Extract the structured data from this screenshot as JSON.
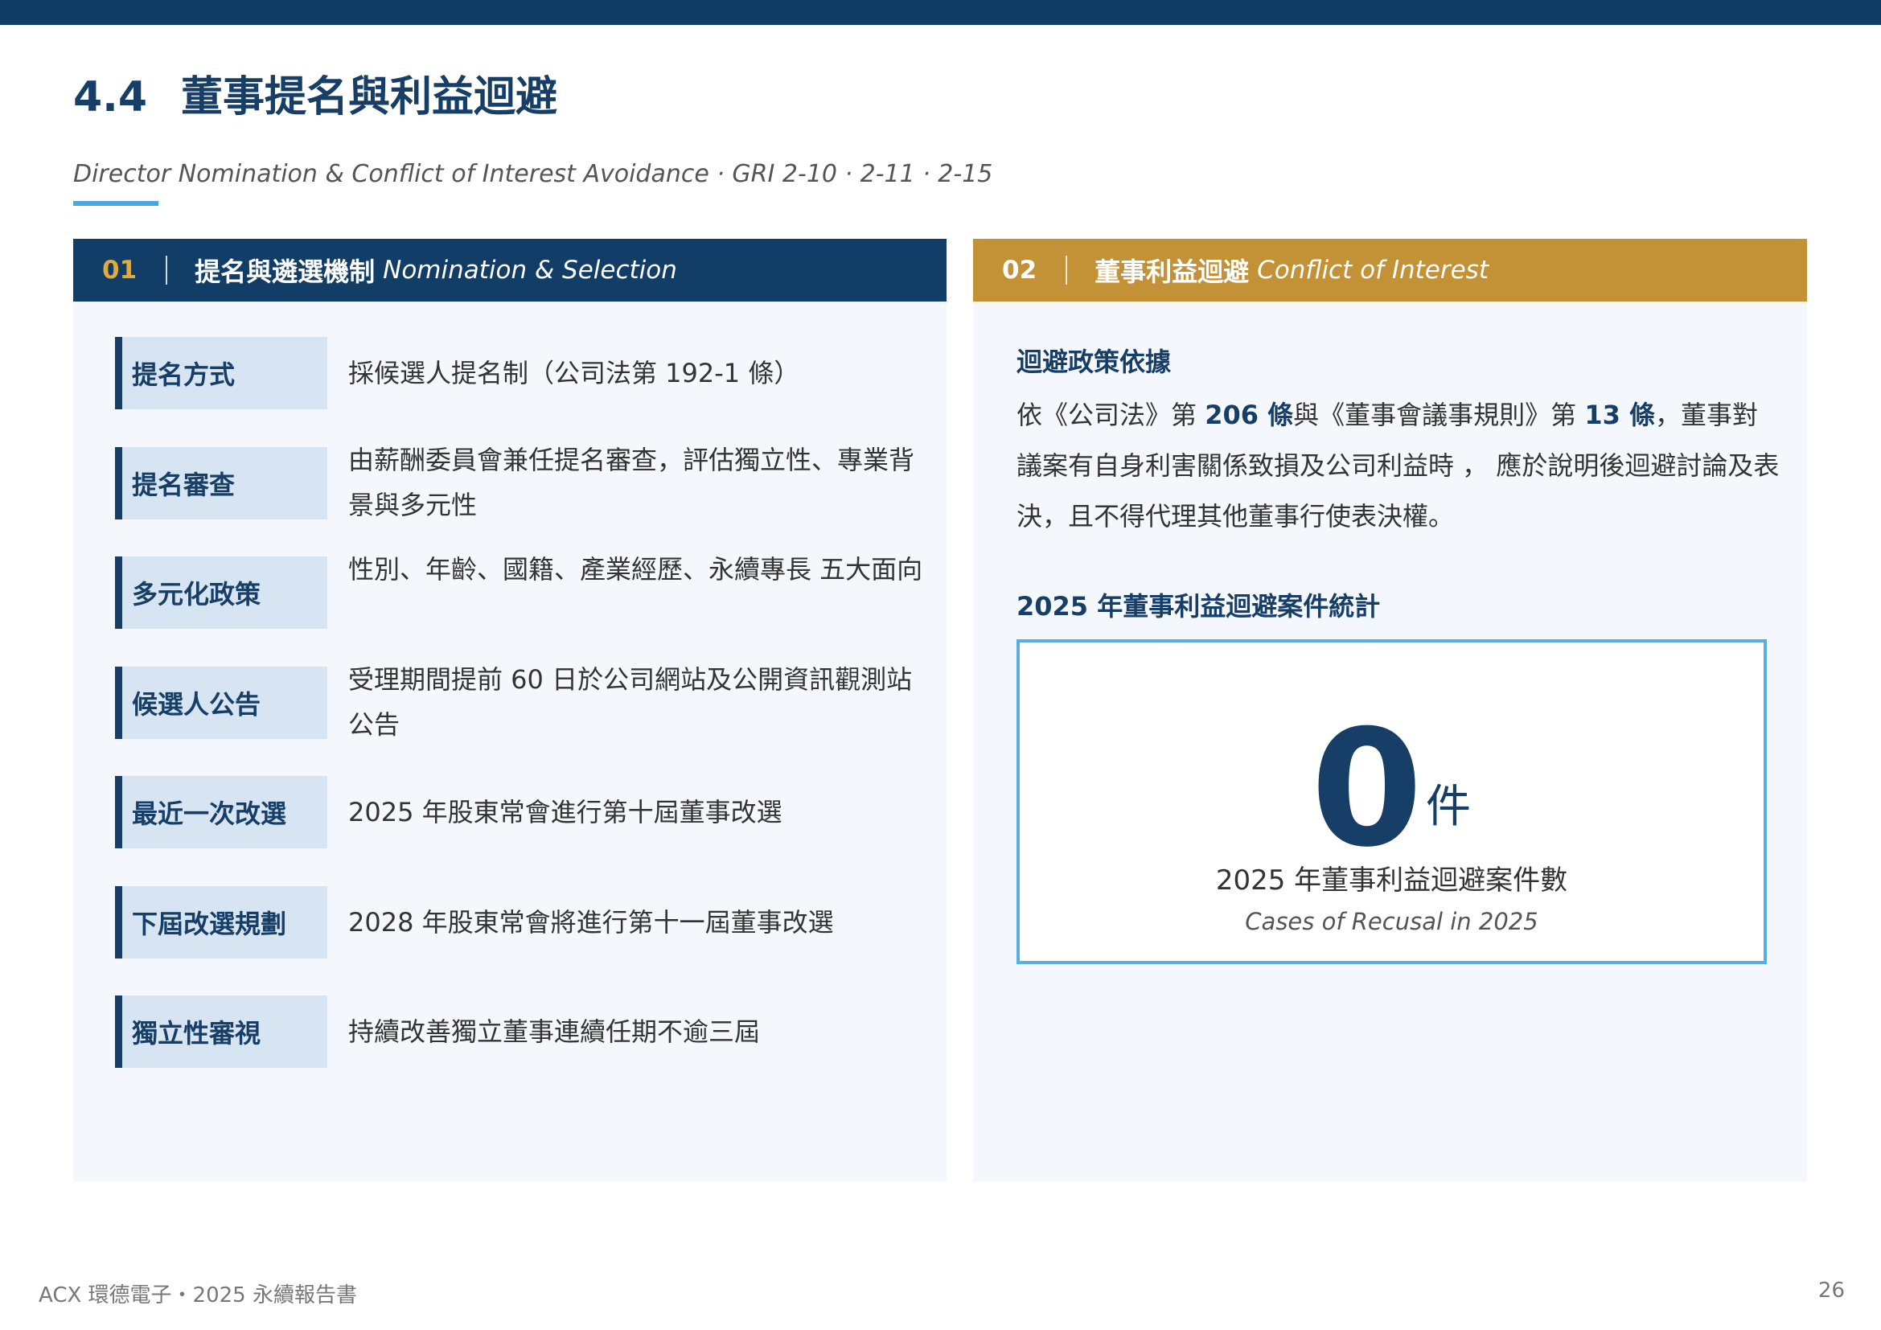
{
  "header": {
    "section_number": "4.4",
    "title": "董事提名與利益迴避",
    "subtitle": "Director Nomination & Conflict of Interest Avoidance · GRI 2-10 · 2-11 · 2-15"
  },
  "left_panel": {
    "number": "01",
    "title_zh": "提名與遴選機制",
    "title_en": "Nomination & Selection",
    "rows": [
      {
        "label": "提名方式",
        "value": "採候選人提名制（公司法第 192-1 條）"
      },
      {
        "label": "提名審查",
        "value": "由薪酬委員會兼任提名審查，評估獨立性、專業背景與多元性"
      },
      {
        "label": "多元化政策",
        "value": "性別、年齡、國籍、產業經歷、永續專長 五大面向"
      },
      {
        "label": "候選人公告",
        "value": "受理期間提前 60 日於公司網站及公開資訊觀測站公告"
      },
      {
        "label": "最近一次改選",
        "value": "2025 年股東常會進行第十屆董事改選"
      },
      {
        "label": "下屆改選規劃",
        "value": "2028 年股東常會將進行第十一屆董事改選"
      },
      {
        "label": "獨立性審視",
        "value": "持續改善獨立董事連續任期不逾三屆"
      }
    ]
  },
  "right_panel": {
    "number": "02",
    "title_zh": "董事利益迴避",
    "title_en": "Conflict of Interest",
    "policy_heading": "迴避政策依據",
    "policy_text": {
      "p1": "依《公司法》第 ",
      "article1": "206 條",
      "p2": "與《董事會議事規則》第 ",
      "article2": "13 條",
      "p3": "，董事對議案有自身利害關係致損及公司利益時 ， 應於說明後迴避討論及表決，且不得代理其他董事行使表決權。"
    },
    "stats_heading": "2025 年董事利益迴避案件統計",
    "stat": {
      "value": "0",
      "unit": "件",
      "label_zh": "2025 年董事利益迴避案件數",
      "label_en": "Cases of Recusal in 2025"
    }
  },
  "footer": {
    "left": "ACX 環德電子・2025 永續報告書",
    "page_number": "26"
  },
  "colors": {
    "navy": "#113d66",
    "gold": "#c39236",
    "accent_blue": "#4aa8e0",
    "label_bg": "#d7e5f2",
    "panel_bg": "#f4f7fb"
  }
}
